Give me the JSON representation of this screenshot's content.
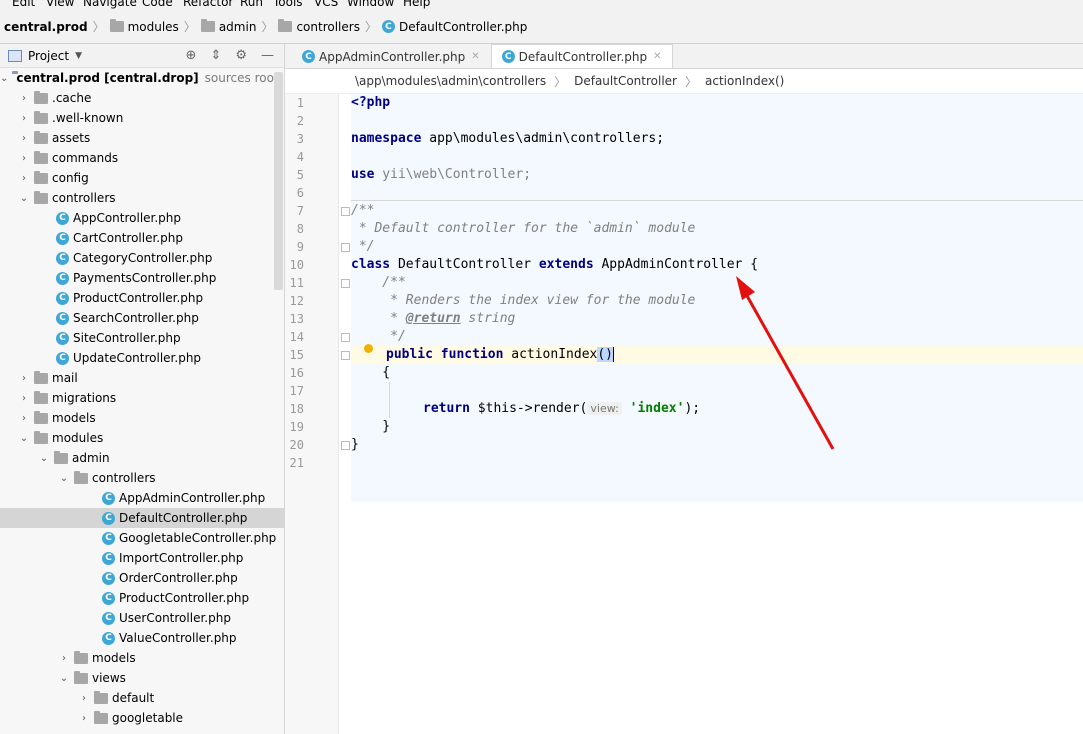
{
  "menu": [
    "Edit",
    "View",
    "Navigate",
    "Code",
    "Refactor",
    "Run",
    "Tools",
    "VCS",
    "Window",
    "Help"
  ],
  "breadcrumb": [
    "central.prod",
    "modules",
    "admin",
    "controllers",
    "DefaultController.php"
  ],
  "project": {
    "title": "Project",
    "root": {
      "name": "central.prod [central.drop]",
      "extra": "sources root, E:\\OS"
    },
    "tree": [
      {
        "label": ".cache"
      },
      {
        "label": ".well-known"
      },
      {
        "label": "assets"
      },
      {
        "label": "commands"
      },
      {
        "label": "config"
      },
      {
        "label": "controllers"
      },
      {
        "label": "AppController.php"
      },
      {
        "label": "CartController.php"
      },
      {
        "label": "CategoryController.php"
      },
      {
        "label": "PaymentsController.php"
      },
      {
        "label": "ProductController.php"
      },
      {
        "label": "SearchController.php"
      },
      {
        "label": "SiteController.php"
      },
      {
        "label": "UpdateController.php"
      },
      {
        "label": "mail"
      },
      {
        "label": "migrations"
      },
      {
        "label": "models"
      },
      {
        "label": "modules"
      },
      {
        "label": "admin"
      },
      {
        "label": "controllers"
      },
      {
        "label": "AppAdminController.php"
      },
      {
        "label": "DefaultController.php"
      },
      {
        "label": "GoogletableController.php"
      },
      {
        "label": "ImportController.php"
      },
      {
        "label": "OrderController.php"
      },
      {
        "label": "ProductController.php"
      },
      {
        "label": "UserController.php"
      },
      {
        "label": "ValueController.php"
      },
      {
        "label": "models"
      },
      {
        "label": "views"
      },
      {
        "label": "default"
      },
      {
        "label": "googletable"
      }
    ]
  },
  "tabs": [
    {
      "label": "AppAdminController.php"
    },
    {
      "label": "DefaultController.php"
    }
  ],
  "editor_breadcrumb": [
    "\\app\\modules\\admin\\controllers",
    "DefaultController",
    "actionIndex()"
  ],
  "code": {
    "l1": "<?php",
    "l3_kw": "namespace",
    "l3_rest": " app\\modules\\admin\\controllers;",
    "l5_kw": "use",
    "l5_rest": " yii\\web\\Controller;",
    "l7": "/**",
    "l8": " * Default controller for the `admin` module",
    "l9": " */",
    "l10_kw1": "class",
    "l10_name": " DefaultController ",
    "l10_kw2": "extends",
    "l10_rest": " AppAdminController {",
    "l11": "    /**",
    "l12": "     * Renders the index view for the module",
    "l13_pre": "     * ",
    "l13_tag": "@return",
    "l13_post": " string",
    "l14": "     */",
    "l15_kw1": "public",
    "l15_kw2": "function",
    "l15_name": " actionIndex",
    "l15_paren": "()",
    "l16": "    {",
    "l18_kw": "return",
    "l18_a": " $this->render(",
    "l18_hint": "view:",
    "l18_str": "'index'",
    "l18_b": ");",
    "l19": "    }",
    "l20": "}"
  },
  "line_numbers": [
    "1",
    "2",
    "3",
    "4",
    "5",
    "6",
    "7",
    "8",
    "9",
    "10",
    "11",
    "12",
    "13",
    "14",
    "15",
    "16",
    "17",
    "18",
    "19",
    "20",
    "21"
  ]
}
